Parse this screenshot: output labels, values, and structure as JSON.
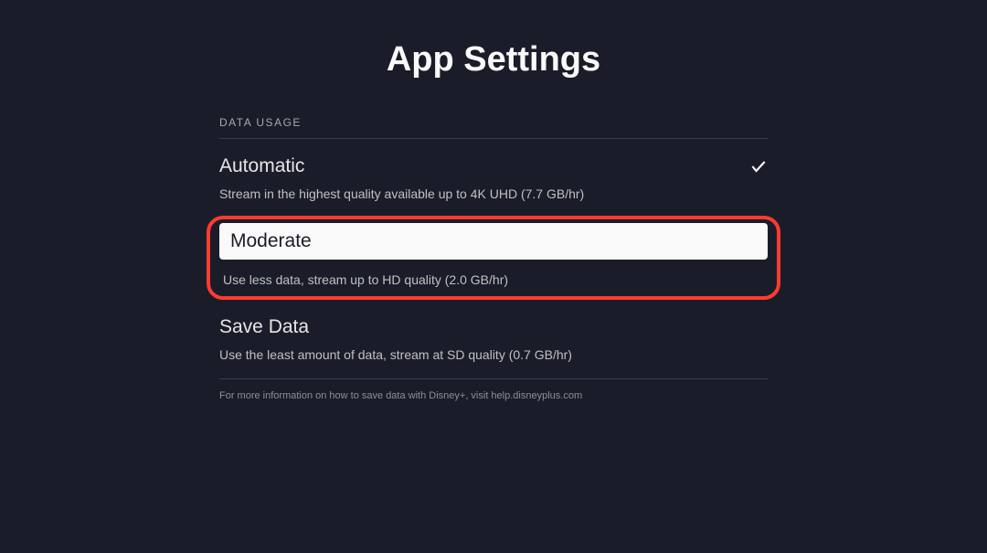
{
  "page": {
    "title": "App Settings"
  },
  "section": {
    "header": "DATA USAGE",
    "footer": "For more information on how to save data with Disney+, visit help.disneyplus.com"
  },
  "options": {
    "automatic": {
      "title": "Automatic",
      "desc": "Stream in the highest quality available up to 4K UHD (7.7 GB/hr)",
      "selected": true
    },
    "moderate": {
      "title": "Moderate",
      "desc": "Use less data, stream up to HD quality (2.0 GB/hr)"
    },
    "save_data": {
      "title": "Save Data",
      "desc": "Use the least amount of data, stream at SD quality (0.7 GB/hr)"
    }
  }
}
